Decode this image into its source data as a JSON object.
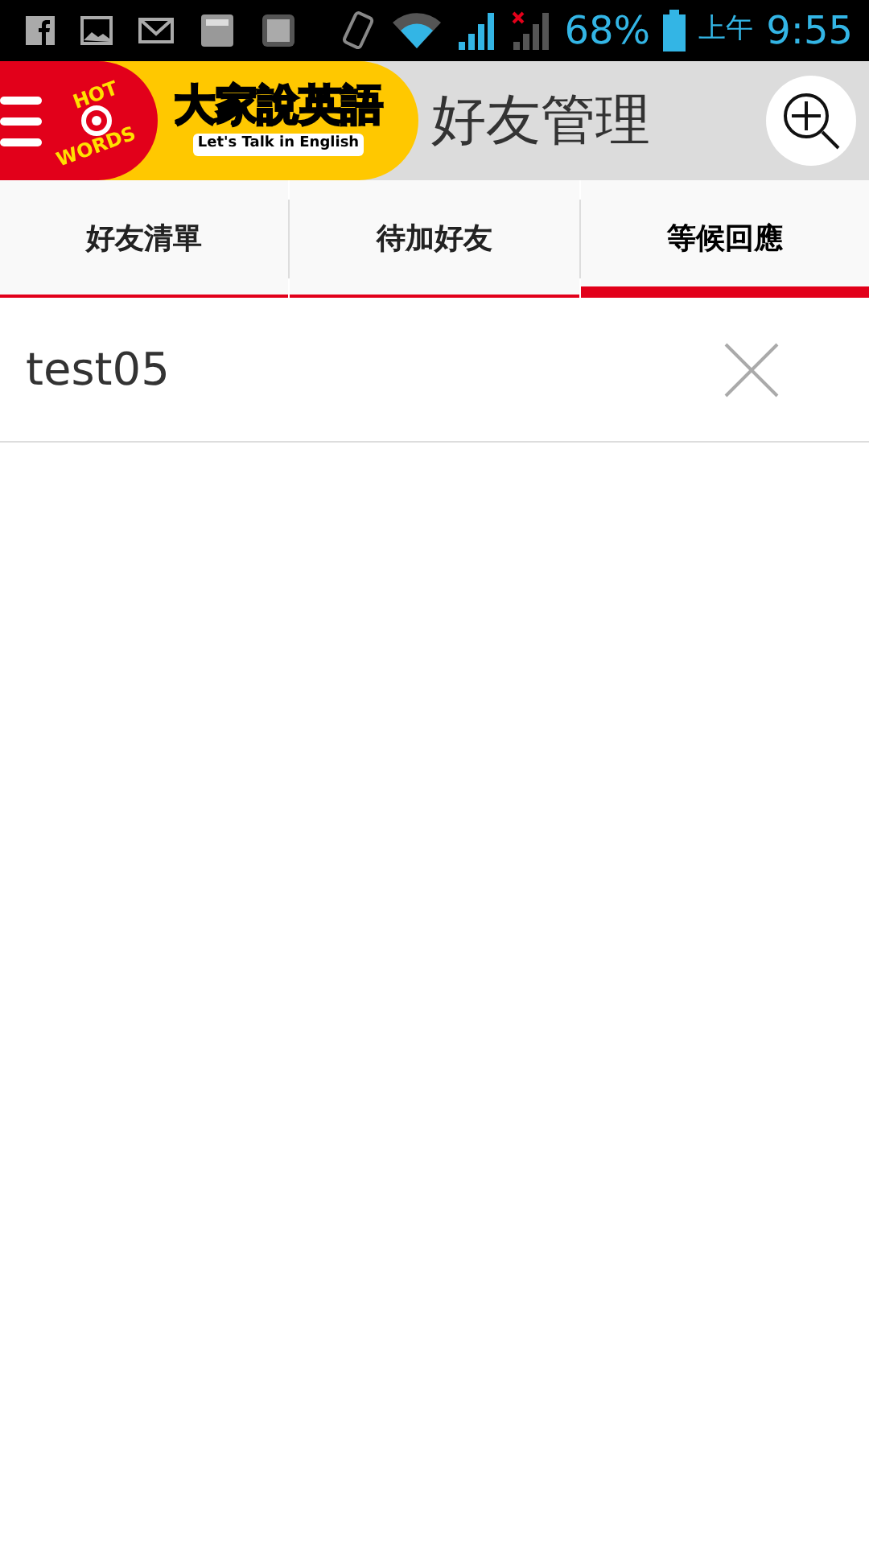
{
  "status_bar": {
    "battery": "68%",
    "period": "上午",
    "time": "9:55"
  },
  "header": {
    "logo": {
      "badge_top": "HOT",
      "badge_bottom": "WORDS",
      "name": "大家說英語",
      "tagline": "Let's Talk in English"
    },
    "title": "好友管理"
  },
  "tabs": [
    {
      "label": "好友清單",
      "selected": false
    },
    {
      "label": "待加好友",
      "selected": false
    },
    {
      "label": "等候回應",
      "selected": true
    }
  ],
  "items": [
    {
      "name": "test05"
    }
  ]
}
